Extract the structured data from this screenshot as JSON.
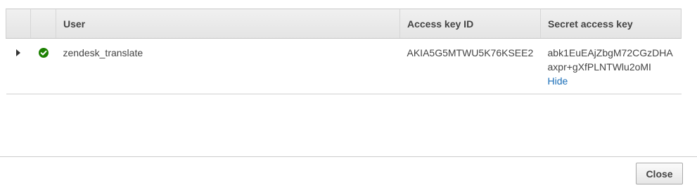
{
  "table": {
    "columns": {
      "user": "User",
      "access_key_id": "Access key ID",
      "secret_access_key": "Secret access key"
    },
    "rows": [
      {
        "user": "zendesk_translate",
        "status_icon": "check-circle-icon",
        "status_color": "#1d8102",
        "access_key_id": "AKIA5G5MTWU5K76KSEE2",
        "secret_line_1": "abk1EuEAjZbgM72CGzDHA",
        "secret_line_2": "axpr+gXfPLNTWlu2oMI",
        "hide_label": "Hide"
      }
    ]
  },
  "footer": {
    "close_label": "Close"
  },
  "colors": {
    "link": "#1a6eb8",
    "success": "#1d8102"
  }
}
